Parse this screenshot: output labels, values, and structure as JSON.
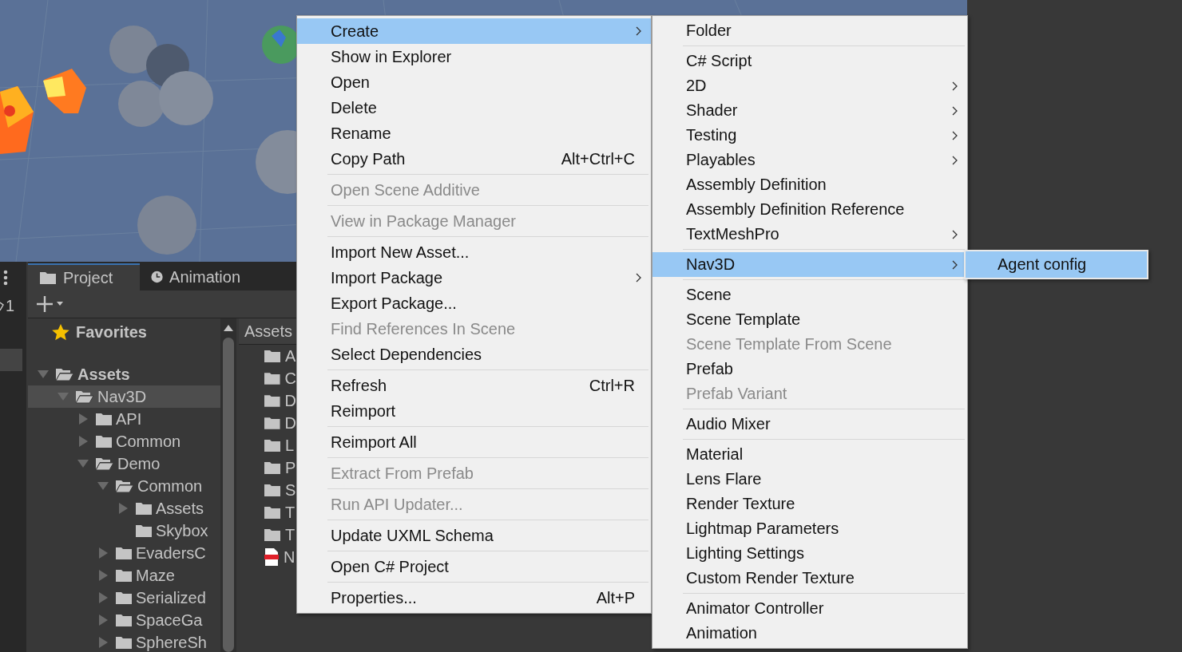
{
  "side_strip": {
    "count": "1"
  },
  "project_panel": {
    "tabs": [
      {
        "label": "Project",
        "selected": true
      },
      {
        "label": "Animation",
        "selected": false
      }
    ],
    "favorites": "Favorites",
    "tree": [
      {
        "label": "Assets",
        "expanded": true,
        "selected": false,
        "children": [
          {
            "label": "Nav3D",
            "expanded": true,
            "selected": true,
            "children": [
              {
                "label": "API",
                "expanded": false,
                "selected": false
              },
              {
                "label": "Common",
                "expanded": false,
                "selected": false
              },
              {
                "label": "Demo",
                "expanded": true,
                "selected": false,
                "children": [
                  {
                    "label": "Common",
                    "expanded": true,
                    "selected": false,
                    "children": [
                      {
                        "label": "Assets",
                        "expanded": false,
                        "selected": false
                      },
                      {
                        "label": "Skybox",
                        "selected": false
                      }
                    ]
                  },
                  {
                    "label": "EvadersC",
                    "expanded": false,
                    "selected": false
                  },
                  {
                    "label": "Maze",
                    "expanded": false,
                    "selected": false
                  },
                  {
                    "label": "Serialized",
                    "expanded": false,
                    "selected": false
                  },
                  {
                    "label": "SpaceGa",
                    "expanded": false,
                    "selected": false
                  },
                  {
                    "label": "SphereSh",
                    "expanded": false,
                    "selected": false
                  }
                ]
              }
            ]
          }
        ]
      }
    ],
    "assets_header": "Assets",
    "asset_items": [
      {
        "kind": "folder",
        "label": "A"
      },
      {
        "kind": "folder",
        "label": "C"
      },
      {
        "kind": "folder",
        "label": "D"
      },
      {
        "kind": "folder",
        "label": "D"
      },
      {
        "kind": "folder",
        "label": "L"
      },
      {
        "kind": "folder",
        "label": "P"
      },
      {
        "kind": "folder",
        "label": "S"
      },
      {
        "kind": "folder",
        "label": "T"
      },
      {
        "kind": "folder",
        "label": "T"
      },
      {
        "kind": "pdf",
        "label": "N"
      }
    ]
  },
  "context_menu": {
    "items": [
      {
        "kind": "item",
        "label": "Create",
        "selected": true,
        "disabled": false,
        "submenu": true
      },
      {
        "kind": "item",
        "label": "Show in Explorer",
        "selected": false,
        "disabled": false,
        "submenu": false
      },
      {
        "kind": "item",
        "label": "Open",
        "selected": false,
        "disabled": false,
        "submenu": false
      },
      {
        "kind": "item",
        "label": "Delete",
        "selected": false,
        "disabled": false,
        "submenu": false
      },
      {
        "kind": "item",
        "label": "Rename",
        "selected": false,
        "disabled": false,
        "submenu": false
      },
      {
        "kind": "item",
        "label": "Copy Path",
        "shortcut": "Alt+Ctrl+C",
        "selected": false,
        "disabled": false,
        "submenu": false
      },
      {
        "kind": "separator"
      },
      {
        "kind": "item",
        "label": "Open Scene Additive",
        "selected": false,
        "disabled": true,
        "submenu": false
      },
      {
        "kind": "separator"
      },
      {
        "kind": "item",
        "label": "View in Package Manager",
        "selected": false,
        "disabled": true,
        "submenu": false
      },
      {
        "kind": "separator"
      },
      {
        "kind": "item",
        "label": "Import New Asset...",
        "selected": false,
        "disabled": false,
        "submenu": false
      },
      {
        "kind": "item",
        "label": "Import Package",
        "selected": false,
        "disabled": false,
        "submenu": true
      },
      {
        "kind": "item",
        "label": "Export Package...",
        "selected": false,
        "disabled": false,
        "submenu": false
      },
      {
        "kind": "item",
        "label": "Find References In Scene",
        "selected": false,
        "disabled": true,
        "submenu": false
      },
      {
        "kind": "item",
        "label": "Select Dependencies",
        "selected": false,
        "disabled": false,
        "submenu": false
      },
      {
        "kind": "separator"
      },
      {
        "kind": "item",
        "label": "Refresh",
        "shortcut": "Ctrl+R",
        "selected": false,
        "disabled": false,
        "submenu": false
      },
      {
        "kind": "item",
        "label": "Reimport",
        "selected": false,
        "disabled": false,
        "submenu": false
      },
      {
        "kind": "separator"
      },
      {
        "kind": "item",
        "label": "Reimport All",
        "selected": false,
        "disabled": false,
        "submenu": false
      },
      {
        "kind": "separator"
      },
      {
        "kind": "item",
        "label": "Extract From Prefab",
        "selected": false,
        "disabled": true,
        "submenu": false
      },
      {
        "kind": "separator"
      },
      {
        "kind": "item",
        "label": "Run API Updater...",
        "selected": false,
        "disabled": true,
        "submenu": false
      },
      {
        "kind": "separator"
      },
      {
        "kind": "item",
        "label": "Update UXML Schema",
        "selected": false,
        "disabled": false,
        "submenu": false
      },
      {
        "kind": "separator"
      },
      {
        "kind": "item",
        "label": "Open C# Project",
        "selected": false,
        "disabled": false,
        "submenu": false
      },
      {
        "kind": "separator"
      },
      {
        "kind": "item",
        "label": "Properties...",
        "shortcut": "Alt+P",
        "selected": false,
        "disabled": false,
        "submenu": false
      }
    ]
  },
  "create_submenu": {
    "items": [
      {
        "kind": "item",
        "label": "Folder",
        "selected": false,
        "disabled": false,
        "submenu": false
      },
      {
        "kind": "separator"
      },
      {
        "kind": "item",
        "label": "C# Script",
        "selected": false,
        "disabled": false,
        "submenu": false
      },
      {
        "kind": "item",
        "label": "2D",
        "selected": false,
        "disabled": false,
        "submenu": true
      },
      {
        "kind": "item",
        "label": "Shader",
        "selected": false,
        "disabled": false,
        "submenu": true
      },
      {
        "kind": "item",
        "label": "Testing",
        "selected": false,
        "disabled": false,
        "submenu": true
      },
      {
        "kind": "item",
        "label": "Playables",
        "selected": false,
        "disabled": false,
        "submenu": true
      },
      {
        "kind": "item",
        "label": "Assembly Definition",
        "selected": false,
        "disabled": false,
        "submenu": false
      },
      {
        "kind": "item",
        "label": "Assembly Definition Reference",
        "selected": false,
        "disabled": false,
        "submenu": false
      },
      {
        "kind": "item",
        "label": "TextMeshPro",
        "selected": false,
        "disabled": false,
        "submenu": true
      },
      {
        "kind": "separator"
      },
      {
        "kind": "item",
        "label": "Nav3D",
        "selected": true,
        "disabled": false,
        "submenu": true
      },
      {
        "kind": "separator"
      },
      {
        "kind": "item",
        "label": "Scene",
        "selected": false,
        "disabled": false,
        "submenu": false
      },
      {
        "kind": "item",
        "label": "Scene Template",
        "selected": false,
        "disabled": false,
        "submenu": false
      },
      {
        "kind": "item",
        "label": "Scene Template From Scene",
        "selected": false,
        "disabled": true,
        "submenu": false
      },
      {
        "kind": "item",
        "label": "Prefab",
        "selected": false,
        "disabled": false,
        "submenu": false
      },
      {
        "kind": "item",
        "label": "Prefab Variant",
        "selected": false,
        "disabled": true,
        "submenu": false
      },
      {
        "kind": "separator"
      },
      {
        "kind": "item",
        "label": "Audio Mixer",
        "selected": false,
        "disabled": false,
        "submenu": false
      },
      {
        "kind": "separator"
      },
      {
        "kind": "item",
        "label": "Material",
        "selected": false,
        "disabled": false,
        "submenu": false
      },
      {
        "kind": "item",
        "label": "Lens Flare",
        "selected": false,
        "disabled": false,
        "submenu": false
      },
      {
        "kind": "item",
        "label": "Render Texture",
        "selected": false,
        "disabled": false,
        "submenu": false
      },
      {
        "kind": "item",
        "label": "Lightmap Parameters",
        "selected": false,
        "disabled": false,
        "submenu": false
      },
      {
        "kind": "item",
        "label": "Lighting Settings",
        "selected": false,
        "disabled": false,
        "submenu": false
      },
      {
        "kind": "item",
        "label": "Custom Render Texture",
        "selected": false,
        "disabled": false,
        "submenu": false
      },
      {
        "kind": "separator"
      },
      {
        "kind": "item",
        "label": "Animator Controller",
        "selected": false,
        "disabled": false,
        "submenu": false
      },
      {
        "kind": "item",
        "label": "Animation",
        "selected": false,
        "disabled": false,
        "submenu": false
      }
    ]
  },
  "nav3d_submenu": {
    "items": [
      {
        "kind": "item",
        "label": "Agent config",
        "selected": true,
        "disabled": false,
        "submenu": false
      }
    ]
  }
}
